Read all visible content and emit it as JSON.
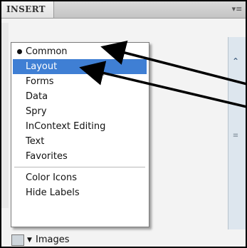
{
  "panel": {
    "tab_label": "INSERT",
    "menu_icon": "panel-options-icon"
  },
  "dropdown": {
    "items": [
      {
        "label": "Common",
        "checked": true
      },
      {
        "label": "Layout",
        "selected": true
      },
      {
        "label": "Forms"
      },
      {
        "label": "Data"
      },
      {
        "label": "Spry"
      },
      {
        "label": "InContext Editing"
      },
      {
        "label": "Text"
      },
      {
        "label": "Favorites"
      }
    ],
    "options": [
      {
        "label": "Color Icons"
      },
      {
        "label": "Hide Labels"
      }
    ]
  },
  "bottom": {
    "images_label": "Images",
    "images_icon": "image-icon"
  },
  "colors": {
    "selection": "#3f7fd4",
    "callout_arrow": "#000000"
  }
}
